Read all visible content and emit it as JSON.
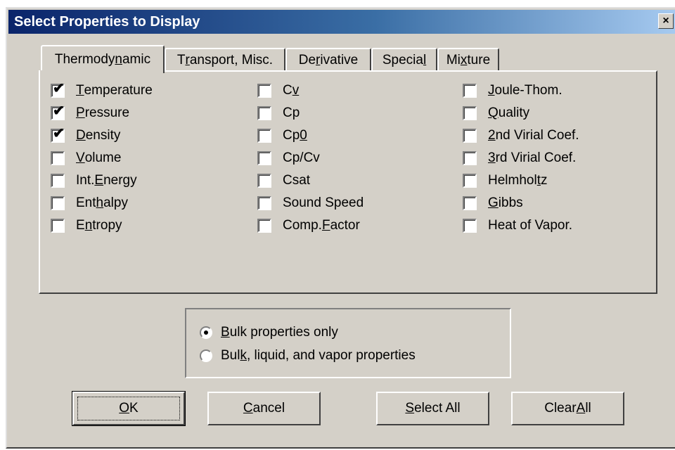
{
  "window": {
    "title": "Select Properties to Display",
    "close_glyph": "×"
  },
  "tabs": [
    {
      "pre": "Thermody",
      "acc": "n",
      "post": "amic",
      "active": true
    },
    {
      "pre": "T",
      "acc": "r",
      "post": "ansport, Misc.",
      "active": false
    },
    {
      "pre": "De",
      "acc": "r",
      "post": "ivative",
      "active": false
    },
    {
      "pre": "Specia",
      "acc": "l",
      "post": "",
      "active": false
    },
    {
      "pre": "Mi",
      "acc": "x",
      "post": "ture",
      "active": false
    }
  ],
  "columns": [
    [
      {
        "pre": "",
        "acc": "T",
        "post": "emperature",
        "checked": true
      },
      {
        "pre": "",
        "acc": "P",
        "post": "ressure",
        "checked": true
      },
      {
        "pre": "",
        "acc": "D",
        "post": "ensity",
        "checked": true
      },
      {
        "pre": "",
        "acc": "V",
        "post": "olume",
        "checked": false
      },
      {
        "pre": "Int. ",
        "acc": "E",
        "post": "nergy",
        "checked": false
      },
      {
        "pre": "Ent",
        "acc": "h",
        "post": "alpy",
        "checked": false
      },
      {
        "pre": "E",
        "acc": "n",
        "post": "tropy",
        "checked": false
      }
    ],
    [
      {
        "pre": "C",
        "acc": "v",
        "post": "",
        "checked": false
      },
      {
        "pre": "Cp",
        "acc": "",
        "post": "",
        "checked": false
      },
      {
        "pre": "Cp",
        "acc": "0",
        "post": "",
        "checked": false
      },
      {
        "pre": "Cp/Cv",
        "acc": "",
        "post": "",
        "checked": false
      },
      {
        "pre": "Csat",
        "acc": "",
        "post": "",
        "checked": false
      },
      {
        "pre": "Sound Speed",
        "acc": "",
        "post": "",
        "checked": false
      },
      {
        "pre": "Comp. ",
        "acc": "F",
        "post": "actor",
        "checked": false
      }
    ],
    [
      {
        "pre": "",
        "acc": "J",
        "post": "oule-Thom.",
        "checked": false
      },
      {
        "pre": "",
        "acc": "Q",
        "post": "uality",
        "checked": false
      },
      {
        "pre": "",
        "acc": "2",
        "post": "nd Virial Coef.",
        "checked": false
      },
      {
        "pre": "",
        "acc": "3",
        "post": "rd Virial Coef.",
        "checked": false
      },
      {
        "pre": "Helmhol",
        "acc": "t",
        "post": "z",
        "checked": false
      },
      {
        "pre": "",
        "acc": "G",
        "post": "ibbs",
        "checked": false
      },
      {
        "pre": "Heat of Vapor.",
        "acc": "",
        "post": "",
        "checked": false
      }
    ]
  ],
  "radios": [
    {
      "pre": "",
      "acc": "B",
      "post": "ulk properties only",
      "selected": true
    },
    {
      "pre": "Bul",
      "acc": "k",
      "post": ", liquid, and vapor properties",
      "selected": false
    }
  ],
  "buttons": [
    {
      "id": "ok",
      "pre": "",
      "acc": "O",
      "post": "K",
      "default": true
    },
    {
      "id": "cancel",
      "pre": "",
      "acc": "C",
      "post": "ancel",
      "default": false
    },
    {
      "id": "select-all",
      "pre": "",
      "acc": "S",
      "post": "elect All",
      "default": false
    },
    {
      "id": "clear-all",
      "pre": "Clear ",
      "acc": "A",
      "post": "ll",
      "default": false
    }
  ],
  "check_glyph": "✔"
}
